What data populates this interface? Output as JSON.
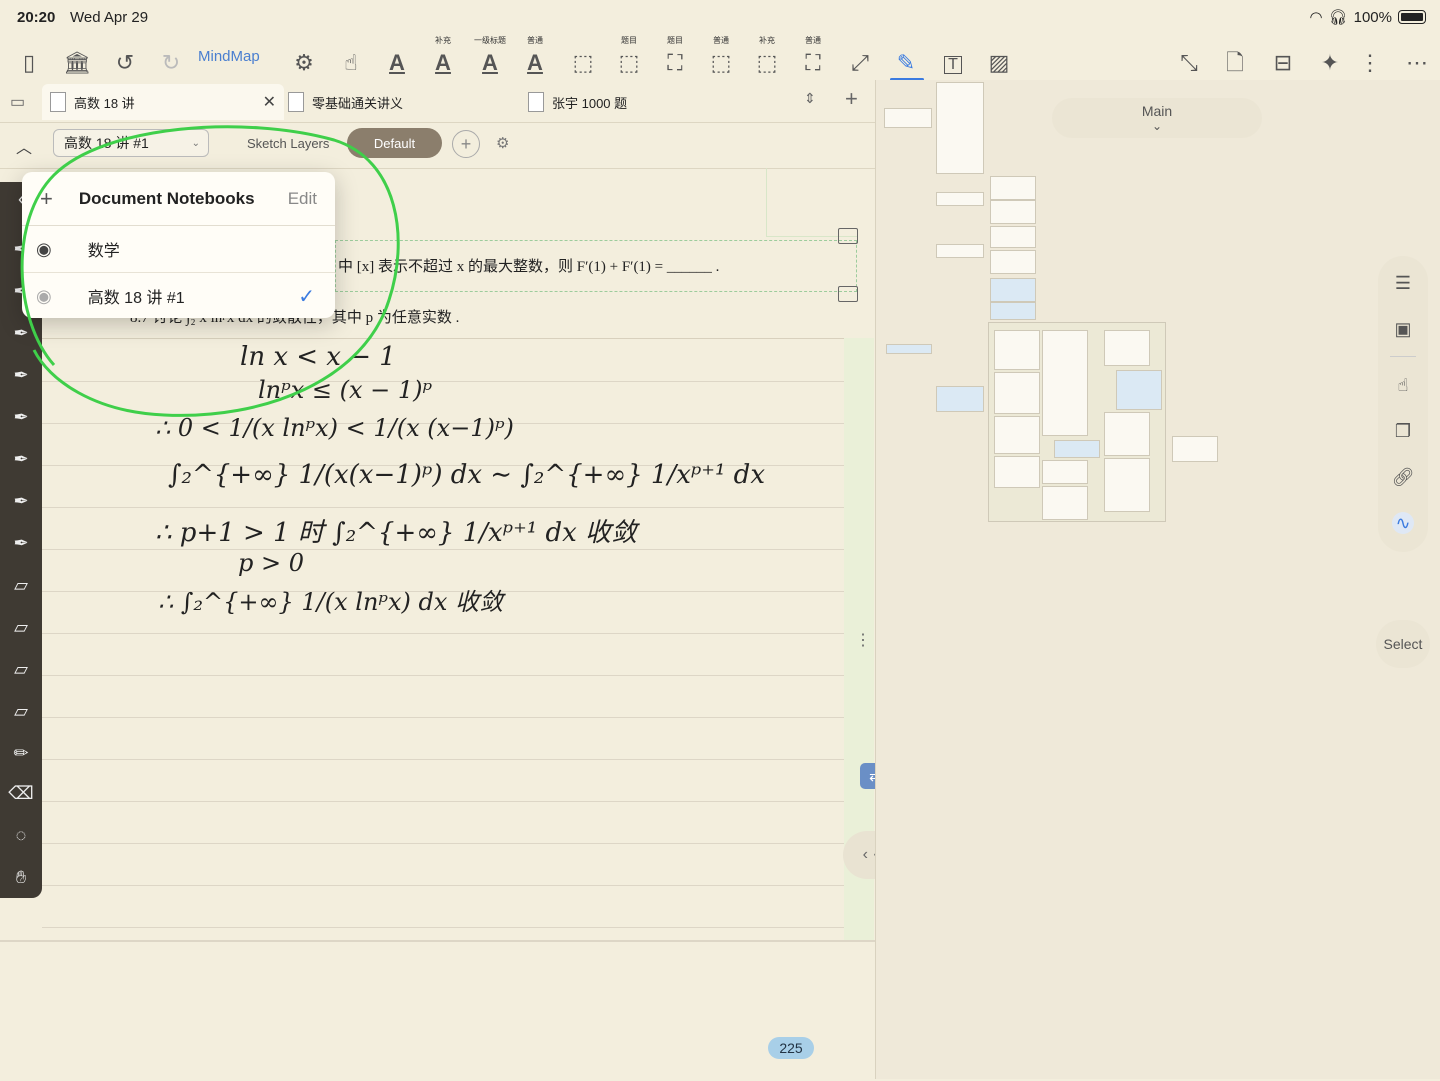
{
  "status": {
    "time": "20:20",
    "date": "Wed Apr 29",
    "battery": "100%"
  },
  "toolbar": {
    "mindmap_label": "MindMap",
    "tags": [
      "补充",
      "一级标题",
      "普通",
      "题目",
      "题目",
      "普通",
      "补充",
      "普通"
    ]
  },
  "tabs": [
    {
      "label": "高数 18 讲",
      "active": true
    },
    {
      "label": "零基础通关讲义",
      "active": false
    },
    {
      "label": "张宇 1000 题",
      "active": false
    }
  ],
  "layerbar": {
    "notebook": "高数 18 讲 #1",
    "sketch_layers": "Sketch Layers",
    "default": "Default"
  },
  "dropdown": {
    "title": "Document Notebooks",
    "edit": "Edit",
    "items": [
      {
        "label": "数学",
        "checked": false
      },
      {
        "label": "高数 18 讲 #1",
        "checked": true
      }
    ]
  },
  "pdf": {
    "line1": "中 [x] 表示不超过 x 的最大整数，则 F′(1) + F′(1) = ______ .",
    "line2": "8.7  讨论 ∫₂ x lnᵖx dx 的敛散性，其中 p 为任意实数 ."
  },
  "handwriting": [
    "ln x < x − 1",
    "lnᵖx ≤ (x − 1)ᵖ",
    "∴ 0 < 1/(x lnᵖx) < 1/(x (x−1)ᵖ)",
    "∫₂^{+∞} 1/(x(x−1)ᵖ) dx ∼ ∫₂^{+∞} 1/xᵖ⁺¹ dx",
    "∴ p+1 > 1 时  ∫₂^{+∞} 1/xᵖ⁺¹ dx 收敛",
    "p > 0",
    "∴ ∫₂^{+∞} 1/(x lnᵖx) dx 收敛"
  ],
  "page_number": "225",
  "right": {
    "main": "Main",
    "select": "Select"
  },
  "colors": {
    "accent": "#3b7be0",
    "annotation_circle": "#3fcf4a",
    "page": "#f3eedd"
  }
}
